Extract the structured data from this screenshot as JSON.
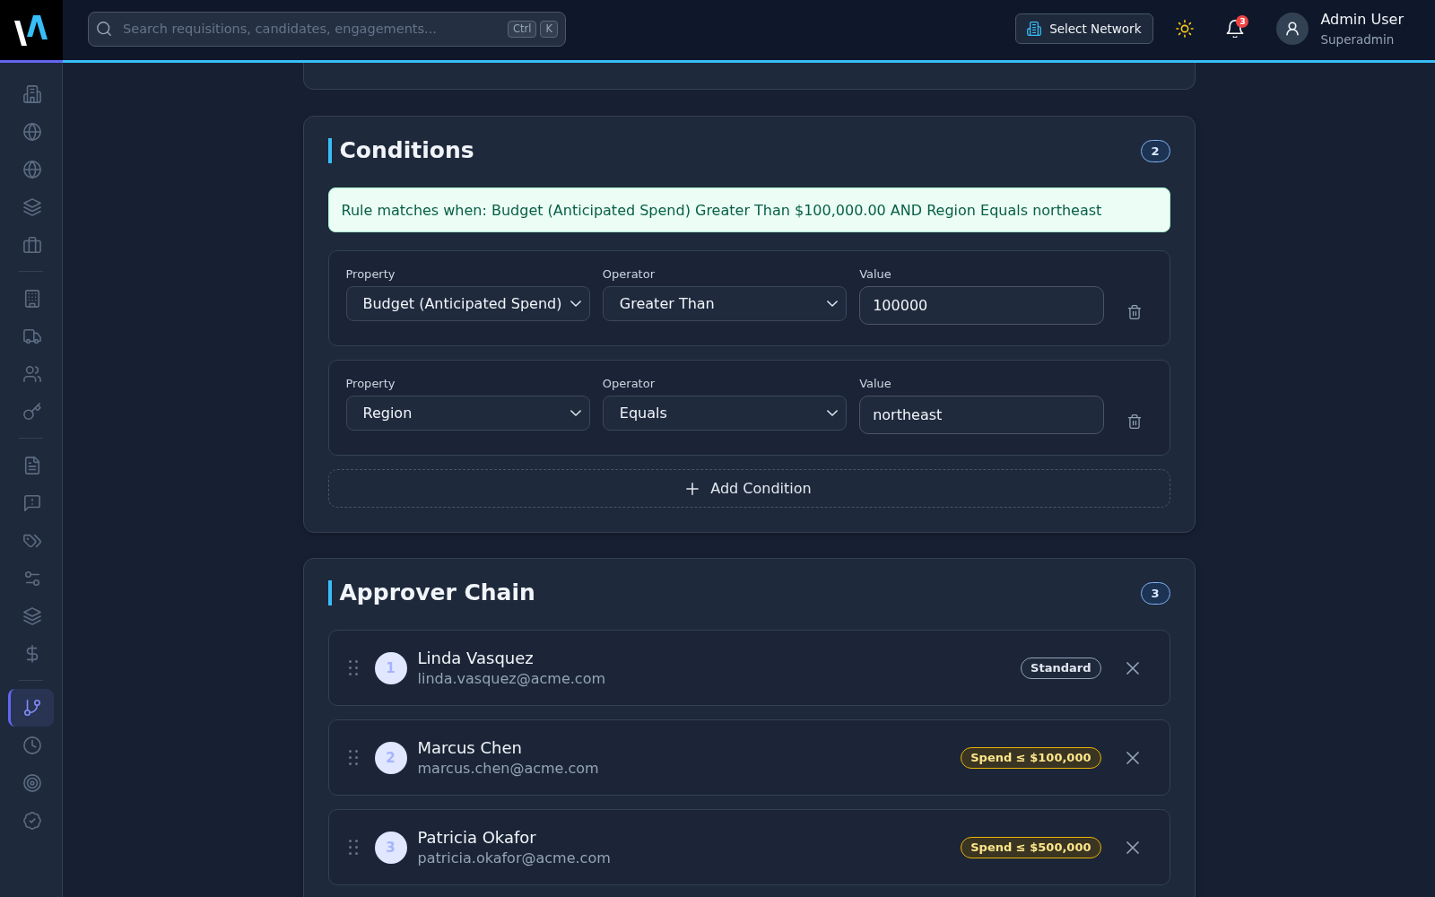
{
  "topbar": {
    "search": {
      "placeholder": "Search requisitions, candidates, engagements...",
      "shortcut": [
        "Ctrl",
        "K"
      ]
    },
    "network_button": "Select Network",
    "notifications": {
      "count": "3"
    },
    "user": {
      "name": "Admin User",
      "role": "Superadmin"
    }
  },
  "sidebar": {
    "groups": [
      {
        "items": [
          {
            "selected": false
          },
          {
            "selected": false
          },
          {
            "selected": false
          },
          {
            "selected": false
          },
          {
            "selected": false
          }
        ]
      },
      {
        "items": [
          {
            "selected": false
          },
          {
            "selected": false
          },
          {
            "selected": false
          },
          {
            "selected": false
          }
        ]
      },
      {
        "items": [
          {
            "selected": false
          },
          {
            "selected": false
          },
          {
            "selected": false
          },
          {
            "selected": false
          },
          {
            "selected": false
          },
          {
            "selected": false
          }
        ]
      },
      {
        "items": [
          {
            "selected": true
          },
          {
            "selected": false
          },
          {
            "selected": false
          },
          {
            "selected": false
          }
        ]
      }
    ]
  },
  "conditions": {
    "title": "Conditions",
    "count": "2",
    "summary": "Rule matches when: Budget (Anticipated Spend) Greater Than $100,000.00 AND Region Equals northeast",
    "rows": [
      {
        "property": {
          "label": "Property",
          "value": "Budget (Anticipated Spend)"
        },
        "operator": {
          "label": "Operator",
          "value": "Greater Than"
        },
        "value": {
          "label": "Value",
          "value": "100000"
        }
      },
      {
        "property": {
          "label": "Property",
          "value": "Region"
        },
        "operator": {
          "label": "Operator",
          "value": "Equals"
        },
        "value": {
          "label": "Value",
          "value": "northeast"
        }
      }
    ],
    "add_button": "Add Condition"
  },
  "approver_chain": {
    "title": "Approver Chain",
    "count": "3",
    "approvers": [
      {
        "step": "1",
        "name": "Linda Vasquez",
        "email": "linda.vasquez@acme.com",
        "limit": {
          "kind": "standard",
          "label": "Standard"
        }
      },
      {
        "step": "2",
        "name": "Marcus Chen",
        "email": "marcus.chen@acme.com",
        "limit": {
          "kind": "spend",
          "label": "Spend ≤ $100,000"
        }
      },
      {
        "step": "3",
        "name": "Patricia Okafor",
        "email": "patricia.okafor@acme.com",
        "limit": {
          "kind": "spend",
          "label": "Spend ≤ $500,000"
        }
      }
    ]
  }
}
